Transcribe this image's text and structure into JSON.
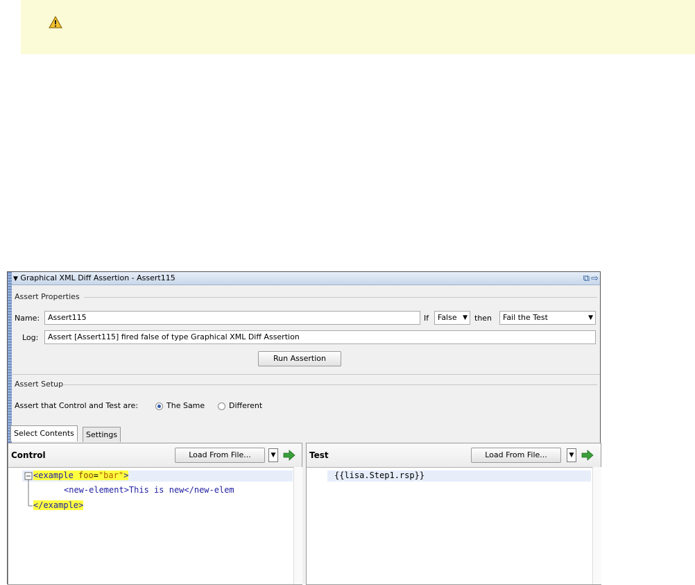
{
  "panel": {
    "title": "Graphical XML Diff Assertion - Assert115",
    "assert_properties_label": "Assert Properties",
    "name_label": "Name:",
    "name_value": "Assert115",
    "if_label": "If",
    "if_value": "False",
    "then_label": "then",
    "then_value": "Fail the Test",
    "log_label": "Log:",
    "log_value": "Assert [Assert115] fired false of type Graphical XML Diff Assertion",
    "run_button": "Run Assertion",
    "assert_setup_label": "Assert Setup",
    "compare_label": "Assert that Control and Test are:",
    "radio_same": "The Same",
    "radio_different": "Different",
    "selected_radio": "The Same",
    "tabs": [
      "Select Contents",
      "Settings"
    ],
    "active_tab": "Select Contents"
  },
  "control": {
    "title": "Control",
    "load_button": "Load From File...",
    "code": {
      "line1_open": "<example ",
      "line1_attr": "foo",
      "line1_eq": "=",
      "line1_str": "\"bar\"",
      "line1_close": ">",
      "line2": "<new-element>This is new</new-elem",
      "line3": "</example>"
    }
  },
  "test": {
    "title": "Test",
    "load_button": "Load From File...",
    "code_line1": "{{lisa.Step1.rsp}}"
  },
  "colors": {
    "warning_bg": "#fcfbd7",
    "highlight": "#ffff40",
    "accent": "#2a5a9a",
    "go_arrow": "#3aa03a"
  }
}
